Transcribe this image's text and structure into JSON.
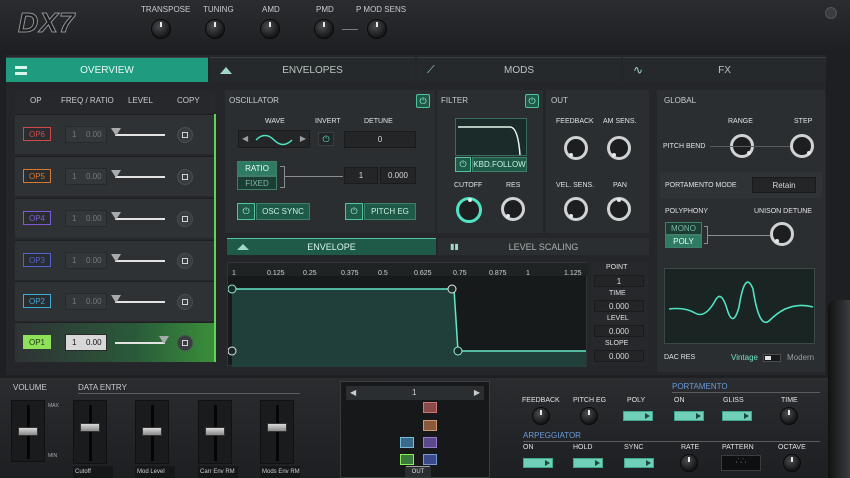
{
  "header": {
    "logo": "DX7",
    "labels": [
      "TRANSPOSE",
      "TUNING",
      "AMD",
      "PMD",
      "P MOD SENS"
    ]
  },
  "tabs": [
    "OVERVIEW",
    "ENVELOPES",
    "MODS",
    "FX"
  ],
  "ops": {
    "headers": [
      "OP",
      "FREQ / RATIO",
      "LEVEL",
      "COPY"
    ],
    "rows": [
      {
        "name": "OP6",
        "color": "#d24848",
        "ratio": "1",
        "fine": "0.00"
      },
      {
        "name": "OP5",
        "color": "#d8782c",
        "ratio": "1",
        "fine": "0.00"
      },
      {
        "name": "OP4",
        "color": "#7f5ad8",
        "ratio": "1",
        "fine": "0.00"
      },
      {
        "name": "OP3",
        "color": "#4d61cf",
        "ratio": "1",
        "fine": "0.00"
      },
      {
        "name": "OP2",
        "color": "#3da9d6",
        "ratio": "1",
        "fine": "0.00"
      },
      {
        "name": "OP1",
        "color": "#8ee25a",
        "ratio": "1",
        "fine": "0.00"
      }
    ]
  },
  "osc": {
    "title": "OSCILLATOR",
    "wave": "WAVE",
    "invert": "INVERT",
    "detune": "DETUNE",
    "detune_val": "0",
    "ratio": "RATIO",
    "fixed": "FIXED",
    "coarse": "1",
    "fine": "0.000",
    "osc_sync": "OSC SYNC",
    "pitch_eg": "PITCH EG"
  },
  "filter": {
    "title": "FILTER",
    "kbd": "KBD.FOLLOW",
    "cutoff": "CUTOFF",
    "res": "RES"
  },
  "out": {
    "title": "OUT",
    "feedback": "FEEDBACK",
    "am": "AM SENS.",
    "vel": "VEL. SENS.",
    "pan": "PAN"
  },
  "global": {
    "title": "GLOBAL",
    "range": "RANGE",
    "step": "STEP",
    "pitch_bend": "PITCH BEND",
    "portamento_mode": "PORTAMENTO MODE",
    "portamento_val": "Retain",
    "polyphony": "POLYPHONY",
    "unison": "UNISON DETUNE",
    "mono": "MONO",
    "poly": "POLY",
    "dac": "DAC RES",
    "vintage": "Vintage",
    "modern": "Modern"
  },
  "env": {
    "tab1": "ENVELOPE",
    "tab2": "LEVEL SCALING",
    "ticks": [
      "1",
      "0.125",
      "0.25",
      "0.375",
      "0.5",
      "0.625",
      "0.75",
      "0.875",
      "1",
      "1.125"
    ],
    "point": "POINT",
    "point_val": "1",
    "time": "TIME",
    "time_val": "0.000",
    "level": "LEVEL",
    "level_val": "0.000",
    "slope": "SLOPE",
    "slope_val": "0.000"
  },
  "bottom": {
    "volume": "VOLUME",
    "data_entry": "DATA ENTRY",
    "faders": [
      "Cutoff",
      "Mod Level",
      "Carr Env RM",
      "Mods Env RM"
    ],
    "max": "MAX",
    "min": "MIN",
    "algo": "1",
    "out": "OUT",
    "row1": [
      "FEEDBACK",
      "PITCH EG",
      "POLY"
    ],
    "portamento": "PORTAMENTO",
    "pr": [
      "ON",
      "GLISS",
      "TIME"
    ],
    "arp": "ARPEGGIATOR",
    "ar": [
      "ON",
      "HOLD",
      "SYNC",
      "RATE",
      "PATTERN",
      "OCTAVE"
    ]
  },
  "colors": {
    "accent": "#4fe3c3",
    "active_tab": "#1f9c7f"
  }
}
